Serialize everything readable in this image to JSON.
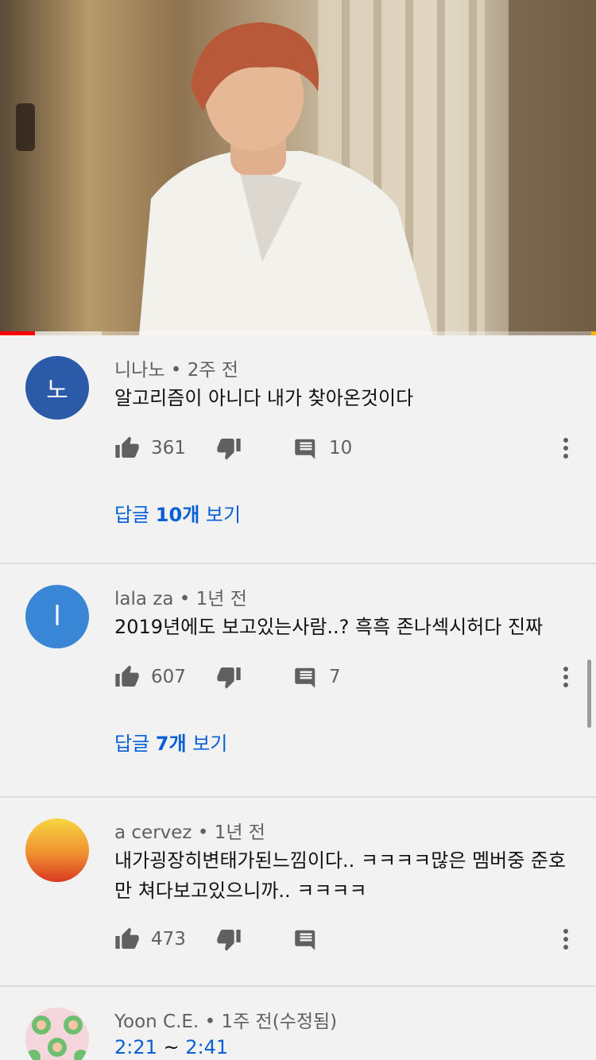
{
  "player": {
    "progress_played_fraction": 0.058,
    "progress_buffered_fraction": 0.17
  },
  "comments": [
    {
      "author": "니나노",
      "sep": "•",
      "time": "2주 전",
      "avatar_letter": "노",
      "avatar_color": "#2b5aa8",
      "text": "알고리즘이 아니다 내가 찾아온것이다",
      "likes": "361",
      "replies": "10",
      "view_replies_prefix": "답글 ",
      "view_replies_count": "10개",
      "view_replies_suffix": " 보기"
    },
    {
      "author": "lala za",
      "sep": "•",
      "time": "1년 전",
      "avatar_letter": "l",
      "avatar_color": "#3a86d6",
      "text": "2019년에도 보고있는사람..? 흑흑 존나섹시허다  진짜",
      "likes": "607",
      "replies": "7",
      "view_replies_prefix": "답글 ",
      "view_replies_count": "7개",
      "view_replies_suffix": " 보기"
    },
    {
      "author": "a cervez",
      "sep": "•",
      "time": "1년 전",
      "avatar_color": "#f0a030",
      "text": "내가굉장히변태가된느낌이다.. ㅋㅋㅋㅋ많은 멤버중 준호만 쳐다보고있으니까.. ㅋㅋㅋㅋ",
      "likes": "473",
      "replies": ""
    },
    {
      "author": "Yoon C.E.",
      "sep": "•",
      "time": "1주 전(수정됨)",
      "ts_start": "2:21",
      "ts_sep": " ~ ",
      "ts_end": "2:41"
    }
  ],
  "icons": {
    "like": "thumb-up-icon",
    "dislike": "thumb-down-icon",
    "reply": "comment-icon",
    "more": "more-vert-icon"
  }
}
